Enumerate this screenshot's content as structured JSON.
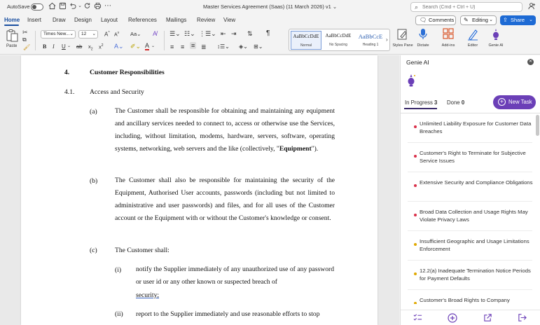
{
  "titlebar": {
    "autosave_label": "AutoSave",
    "document_title": "Master Services Agreement (Saas) (11 March 2026) v1 ⌄",
    "search_placeholder": "Search (Cmd + Ctrl + U)"
  },
  "menu": {
    "tabs": [
      "Home",
      "Insert",
      "Draw",
      "Design",
      "Layout",
      "References",
      "Mailings",
      "Review",
      "View"
    ],
    "active_tab": "Home",
    "comments_label": "Comments",
    "editing_label": "Editing",
    "share_label": "Share"
  },
  "ribbon": {
    "paste_label": "Paste",
    "font_name": "Times New...",
    "font_size": "12",
    "styles": [
      {
        "preview": "AaBbCcDdE",
        "label": "Normal"
      },
      {
        "preview": "AaBbCcDdE",
        "label": "No Spacing"
      },
      {
        "preview": "AaBbCcE",
        "label": "Heading 1"
      }
    ],
    "styles_pane_label": "Styles Pane",
    "dictate_label": "Dictate",
    "addins_label": "Add-ins",
    "editor_label": "Editor",
    "genie_label": "Genie AI"
  },
  "document": {
    "section_number": "4.",
    "section_title": "Customer Responsibilities",
    "clause_number": "4.1.",
    "clause_title": "Access and Security",
    "para_a_label": "(a)",
    "para_a_text_1": "The Customer shall be responsible for obtaining and maintaining any equipment and ancillary services needed to connect to, access or otherwise use the Services, including, without limitation, modems, hardware, servers, software, operating systems, networking, web servers and the like (collectively, \"",
    "para_a_bold": "Equipment",
    "para_a_text_2": "\").",
    "para_b_label": "(b)",
    "para_b_text": "The Customer shall also be responsible for maintaining the security of the Equipment, Authorised User accounts, passwords (including but not limited to administrative and user passwords) and files, and for all uses of the Customer account or the Equipment with or without the Customer's knowledge or consent.",
    "para_c_label": "(c)",
    "para_c_text": "The Customer shall:",
    "sub_i_label": "(i)",
    "sub_i_text": "notify the Supplier immediately of any unauthorized use of any password or user id or any other known or suspected breach of",
    "sub_i_last": "security;",
    "sub_ii_label": "(ii)",
    "sub_ii_text": "report to the Supplier immediately and use reasonable efforts to stop"
  },
  "panel": {
    "title": "Genie AI",
    "in_progress_label": "In Progress",
    "in_progress_count": "3",
    "done_label": "Done",
    "done_count": "0",
    "new_task_label": "New Task",
    "tasks": [
      {
        "title": "Unlimited Liability Exposure for Customer Data Breaches",
        "color": "#d9304a"
      },
      {
        "title": "Customer's Right to Terminate for Subjective Service Issues",
        "color": "#d9304a"
      },
      {
        "title": "Extensive Security and Compliance Obligations",
        "color": "#d9304a"
      },
      {
        "title": "Broad Data Collection and Usage Rights May Violate Privacy Laws",
        "color": "#d9304a"
      },
      {
        "title": "Insufficient Geographic and Usage Limitations Enforcement",
        "color": "#e0a800"
      },
      {
        "title": "12.2(a) Inadequate Termination Notice Periods for Payment Defaults",
        "color": "#e0a800"
      },
      {
        "title": "Customer's Broad Rights to Company",
        "color": "#e0a800"
      }
    ]
  }
}
